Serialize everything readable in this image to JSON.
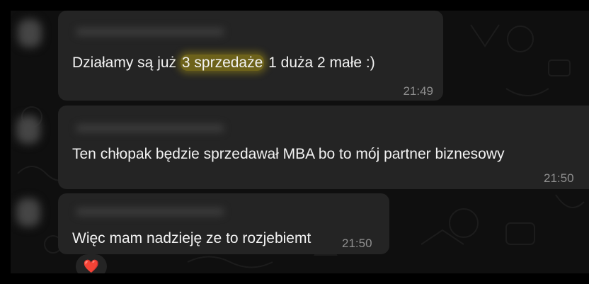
{
  "messages": [
    {
      "text_before": "Działamy są już ",
      "highlight": "3 sprzedaże",
      "text_after": " 1 duża 2 małe :)",
      "time": "21:49"
    },
    {
      "text": "Ten chłopak będzie sprzedawał MBA bo to mój partner biznesowy",
      "time": "21:50"
    },
    {
      "text": "Więc mam nadzieję ze to rozjebiemt",
      "time": "21:50",
      "reaction": "❤️"
    }
  ],
  "colors": {
    "bubble": "#242424",
    "background": "#0f0f0f",
    "highlight": "#aa9614",
    "text": "#f2f2f2",
    "timestamp": "#8f8f8f"
  },
  "icons": {
    "reaction": "red-heart-icon"
  }
}
